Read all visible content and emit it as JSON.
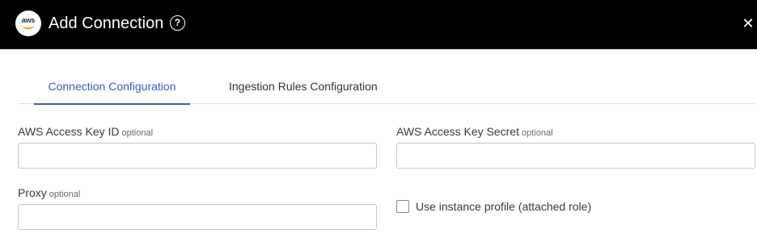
{
  "header": {
    "logo_text": "aws",
    "title": "Add Connection",
    "help_glyph": "?",
    "close_glyph": "✕",
    "background": "#000000",
    "logo_accent": "#ff9900"
  },
  "tabs": [
    {
      "label": "Connection Configuration",
      "active": true
    },
    {
      "label": "Ingestion Rules Configuration",
      "active": false
    }
  ],
  "accent_color": "#3b5bbd",
  "form": {
    "access_key_id": {
      "label": "AWS Access Key ID",
      "hint": "optional",
      "value": "",
      "placeholder": ""
    },
    "access_key_secret": {
      "label": "AWS Access Key Secret",
      "hint": "optional",
      "value": "",
      "placeholder": ""
    },
    "proxy": {
      "label": "Proxy",
      "hint": "optional",
      "value": "",
      "placeholder": ""
    },
    "instance_profile": {
      "label": "Use instance profile (attached role)",
      "checked": false
    }
  }
}
